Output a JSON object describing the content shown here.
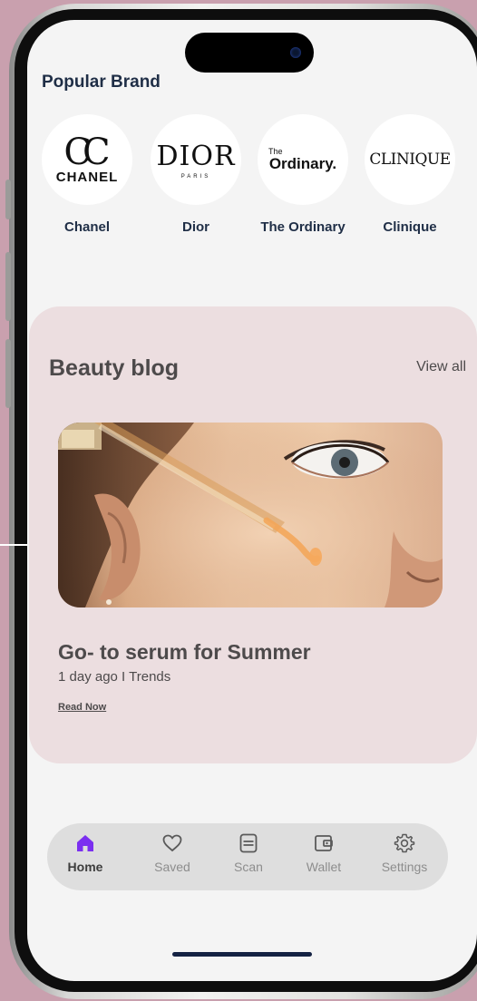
{
  "popular_brand": {
    "title": "Popular Brand",
    "brands": [
      {
        "name": "Chanel",
        "logo_text": "CHANEL"
      },
      {
        "name": "Dior",
        "logo_text": "DIOR",
        "logo_sub": "PARIS"
      },
      {
        "name": "The Ordinary",
        "logo_text": "Ordinary.",
        "logo_small": "The"
      },
      {
        "name": "Clinique",
        "logo_text": "CLINIQUE"
      }
    ]
  },
  "blog": {
    "title": "Beauty blog",
    "view_all": "View all",
    "post_title": "Go- to serum for Summer",
    "post_meta": "1 day ago I Trends",
    "read_now": "Read Now"
  },
  "tabbar": {
    "active_color": "#7b2ff0",
    "items": [
      {
        "label": "Home",
        "icon": "home-icon",
        "active": true
      },
      {
        "label": "Saved",
        "icon": "heart-icon",
        "active": false
      },
      {
        "label": "Scan",
        "icon": "scan-icon",
        "active": false
      },
      {
        "label": "Wallet",
        "icon": "wallet-icon",
        "active": false
      },
      {
        "label": "Settings",
        "icon": "gear-icon",
        "active": false
      }
    ]
  },
  "colors": {
    "background": "#c9a0ae",
    "screen": "#f4f4f4",
    "blog_card": "#ecdee0",
    "heading": "#1f2e46"
  }
}
